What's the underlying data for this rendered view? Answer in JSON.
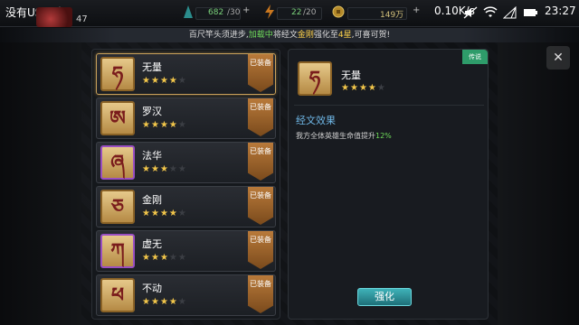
{
  "status_bar": {
    "carrier": "没有USIM卡",
    "speed": "0.10K/s",
    "time": "23:27"
  },
  "player": {
    "level": "47"
  },
  "resources": {
    "stamina": "682",
    "stamina_max": "/30",
    "energy": "22",
    "energy_max": "/20",
    "gold": "149万"
  },
  "notice": {
    "prefix": "百尺竿头须进步,",
    "loading": "加载中",
    "mid": "将经文",
    "item": "金刚",
    "mid2": "强化至",
    "level": "4星",
    "suffix": ",可喜可贺!"
  },
  "list": {
    "equipped_label": "已装备",
    "items": [
      {
        "name": "无量",
        "stars": 4,
        "glyph": "ཧ",
        "border": "gold"
      },
      {
        "name": "罗汉",
        "stars": 4,
        "glyph": "ཨ",
        "border": "gold"
      },
      {
        "name": "法华",
        "stars": 3,
        "glyph": "ཞ",
        "border": "purple"
      },
      {
        "name": "金刚",
        "stars": 4,
        "glyph": "ཅ",
        "border": "gold"
      },
      {
        "name": "虚无",
        "stars": 3,
        "glyph": "ཀ",
        "border": "purple"
      },
      {
        "name": "不动",
        "stars": 4,
        "glyph": "ཕ",
        "border": "gold"
      }
    ]
  },
  "detail": {
    "name": "无量",
    "stars": 4,
    "corner_tag": "传说",
    "effect_title": "经文效果",
    "effect_desc_prefix": "我方全体英雄生命值提升",
    "effect_value": "12%",
    "enhance_label": "强化"
  },
  "colors": {
    "star_on": "#f2c64a",
    "accent_green": "#6fdc5a",
    "accent_yellow": "#ffd34a",
    "effect_title": "#6fb7e6",
    "button": "#3fb2b8"
  }
}
